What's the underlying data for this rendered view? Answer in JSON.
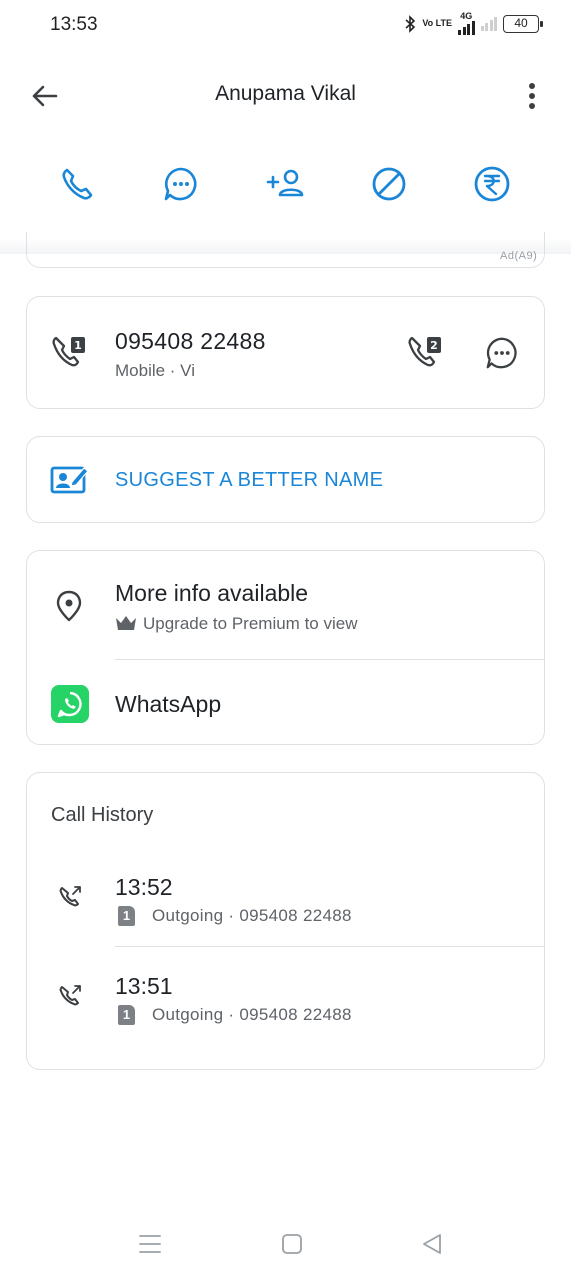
{
  "status_bar": {
    "time": "13:53",
    "network": "4G",
    "volte": "Vo LTE",
    "battery": "40"
  },
  "header": {
    "title": "Anupama Vikal"
  },
  "ad": {
    "label": "Ad(A9)"
  },
  "number_card": {
    "number": "095408 22488",
    "sub": "Mobile · Vi"
  },
  "suggest": {
    "label": "SUGGEST A BETTER NAME"
  },
  "info_card": {
    "more_title": "More info available",
    "more_sub": "Upgrade to Premium to view",
    "whatsapp_label": "WhatsApp"
  },
  "call_history": {
    "title": "Call History",
    "items": [
      {
        "time": "13:52",
        "sim": "1",
        "detail": "Outgoing · 095408 22488"
      },
      {
        "time": "13:51",
        "sim": "1",
        "detail": "Outgoing · 095408 22488"
      }
    ]
  },
  "colors": {
    "accent": "#1a86d8",
    "whatsapp": "#25d366",
    "border": "#dde1e6"
  }
}
